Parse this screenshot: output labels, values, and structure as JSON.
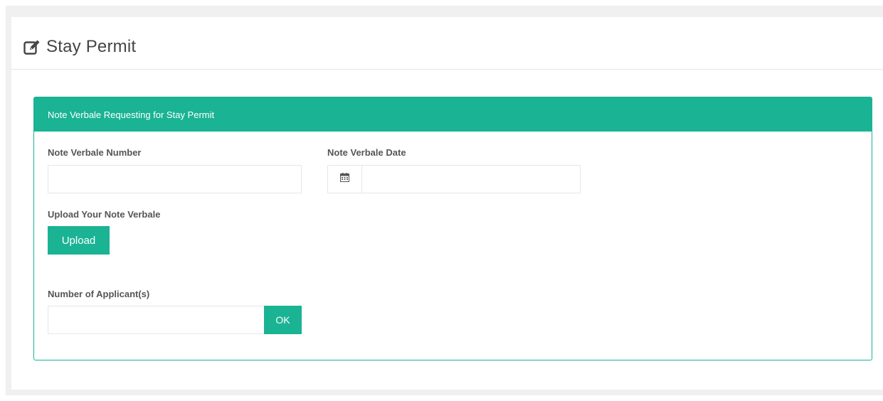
{
  "page": {
    "title": "Stay Permit",
    "title_icon": "edit-icon"
  },
  "panel": {
    "heading": "Note Verbale Requesting for Stay Permit",
    "note_verbale_number": {
      "label": "Note Verbale Number",
      "value": "",
      "placeholder": ""
    },
    "note_verbale_date": {
      "label": "Note Verbale Date",
      "value": "",
      "placeholder": "",
      "icon": "calendar-icon"
    },
    "upload": {
      "label": "Upload Your Note Verbale",
      "button_label": "Upload"
    },
    "applicants": {
      "label": "Number of Applicant(s)",
      "value": "",
      "placeholder": "",
      "button_label": "OK"
    }
  },
  "colors": {
    "accent": "#1ab394",
    "background": "#f0f0f0",
    "card": "#ffffff"
  }
}
